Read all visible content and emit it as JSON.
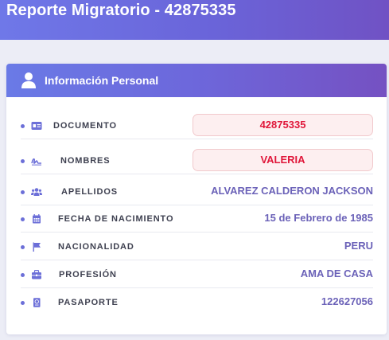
{
  "page": {
    "title": "Reporte Migratorio - 42875335"
  },
  "card": {
    "title": "Información Personal",
    "icon": "user-icon",
    "rows": [
      {
        "label": "DOCUMENTO",
        "value": "42875335",
        "icon": "id-card-icon",
        "highlighted": true
      },
      {
        "label": "NOMBRES",
        "value": "VALERIA",
        "icon": "signature-icon",
        "highlighted": true
      },
      {
        "label": "APELLIDOS",
        "value": "ALVAREZ CALDERON JACKSON",
        "icon": "users-icon",
        "highlighted": false
      },
      {
        "label": "FECHA DE NACIMIENTO",
        "value": "15 de Febrero de 1985",
        "icon": "calendar-icon",
        "highlighted": false
      },
      {
        "label": "NACIONALIDAD",
        "value": "PERU",
        "icon": "flag-icon",
        "highlighted": false
      },
      {
        "label": "PROFESIÓN",
        "value": "AMA DE CASA",
        "icon": "briefcase-icon",
        "highlighted": false
      },
      {
        "label": "PASAPORTE",
        "value": "122627056",
        "icon": "passport-icon",
        "highlighted": false
      }
    ]
  },
  "colors": {
    "accent": "#6c6fd8",
    "value_text": "#6b62b8",
    "highlight_text": "#e0173a",
    "highlight_bg": "#fdeff0",
    "highlight_border": "#f1c9cc"
  }
}
